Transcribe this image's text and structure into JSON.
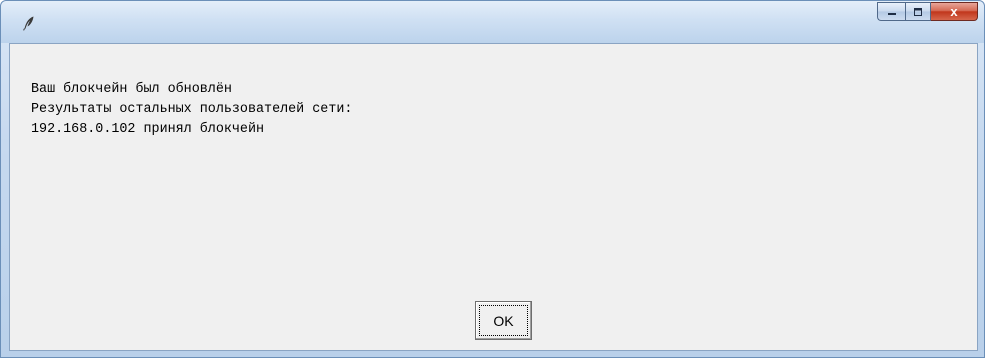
{
  "window": {
    "icon": "feather-icon",
    "controls": {
      "minimize_icon": "minimize-icon",
      "maximize_icon": "maximize-icon",
      "close_icon": "close-icon",
      "close_glyph": "x"
    }
  },
  "dialog": {
    "lines": [
      "Ваш блокчейн был обновлён",
      "Результаты остальных пользователей сети:",
      "192.168.0.102 принял блокчейн"
    ],
    "ok_label": "OK"
  },
  "colors": {
    "client_background": "#f0f0f0",
    "titlebar_top": "#e4eef9",
    "titlebar_bottom": "#bcd3ec",
    "close_button": "#c1361c"
  }
}
